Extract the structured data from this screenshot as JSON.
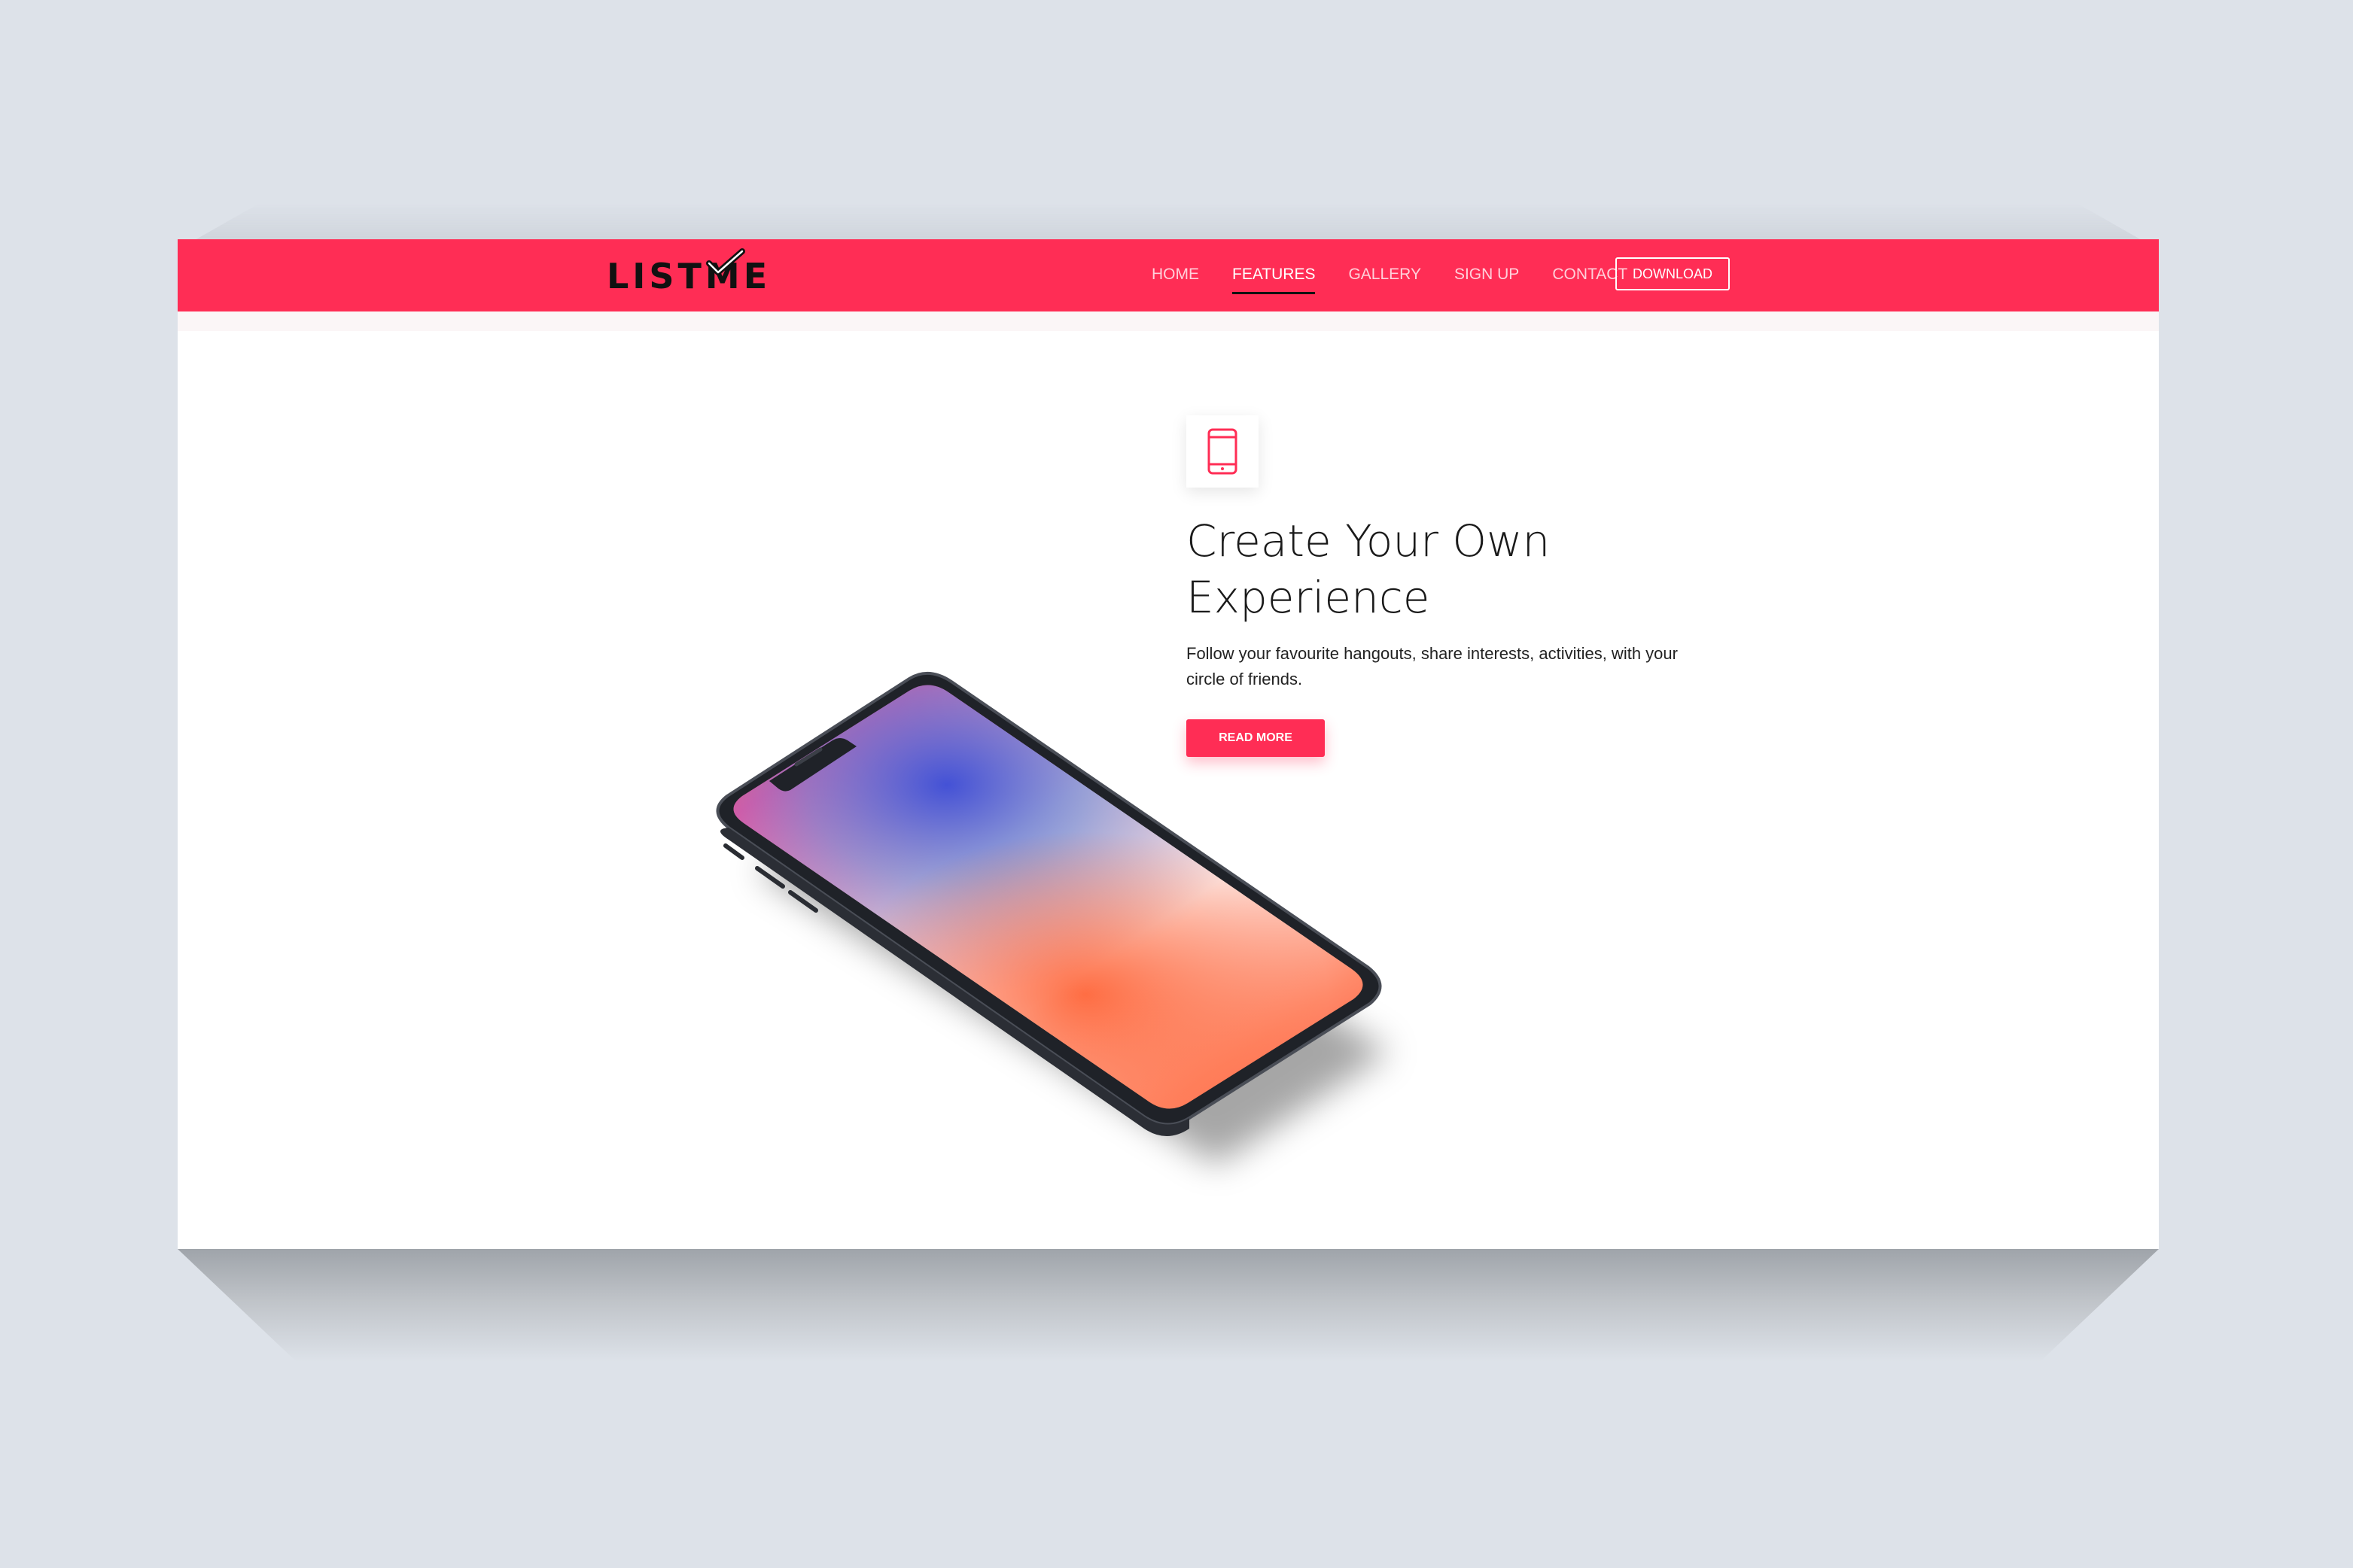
{
  "brand": {
    "name": "LISTME",
    "accent_color": "#ff2d55"
  },
  "nav": {
    "items": [
      {
        "label": "HOME",
        "active": false
      },
      {
        "label": "FEATURES",
        "active": true
      },
      {
        "label": "GALLERY",
        "active": false
      },
      {
        "label": "SIGN UP",
        "active": false
      },
      {
        "label": "CONTACT",
        "active": false
      }
    ],
    "download_label": "DOWNLOAD"
  },
  "feature": {
    "icon": "tablet-icon",
    "title_line1": "Create Your Own",
    "title_line2": "Experience",
    "description_line1": "Follow your favourite hangouts, share interests, activities, with your",
    "description_line2": "circle of friends.",
    "button_label": "READ MORE"
  },
  "illustration": {
    "icon": "smartphone-mockup"
  }
}
